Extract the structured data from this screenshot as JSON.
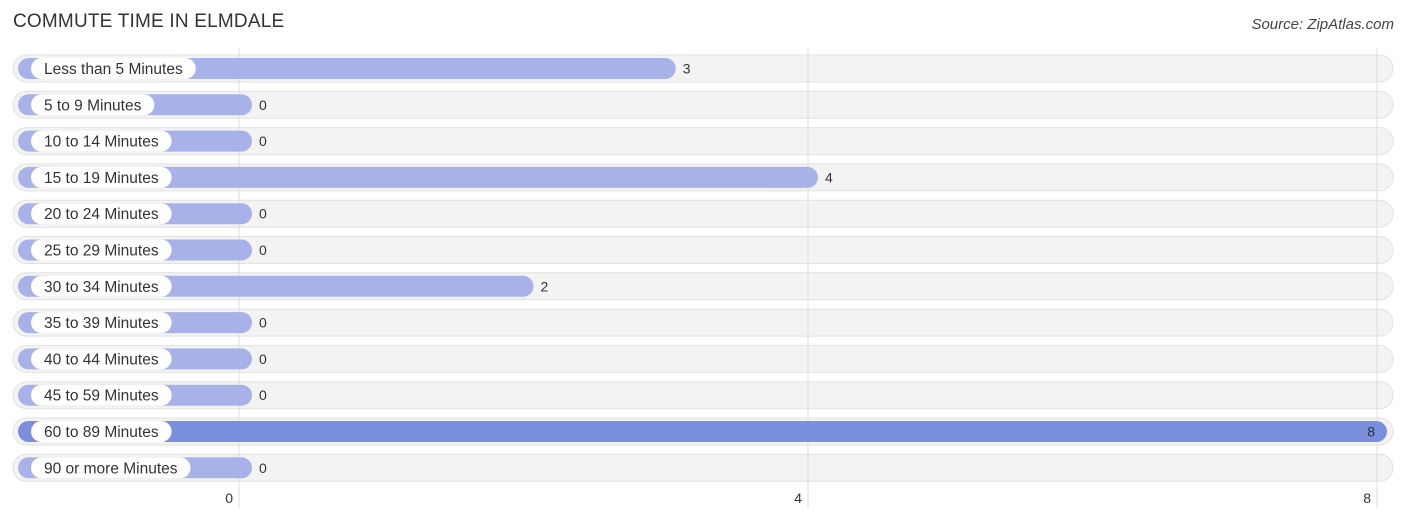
{
  "header": {
    "title": "COMMUTE TIME IN ELMDALE",
    "source": "Source: ZipAtlas.com"
  },
  "colors": {
    "bar": "#a7b3e8",
    "bar_highlight": "#7b8fdd",
    "track": "#f3f3f3",
    "grid": "#dddddd"
  },
  "chart_data": {
    "type": "bar",
    "orientation": "horizontal",
    "title": "COMMUTE TIME IN ELMDALE",
    "xlabel": "",
    "ylabel": "",
    "categories": [
      "Less than 5 Minutes",
      "5 to 9 Minutes",
      "10 to 14 Minutes",
      "15 to 19 Minutes",
      "20 to 24 Minutes",
      "25 to 29 Minutes",
      "30 to 34 Minutes",
      "35 to 39 Minutes",
      "40 to 44 Minutes",
      "45 to 59 Minutes",
      "60 to 89 Minutes",
      "90 or more Minutes"
    ],
    "values": [
      3,
      0,
      0,
      4,
      0,
      0,
      2,
      0,
      0,
      0,
      8,
      0
    ],
    "xlim": [
      0,
      8
    ],
    "xticks": [
      0,
      4,
      8
    ],
    "xtick_labels": [
      "0",
      "4",
      "8"
    ],
    "grid": true,
    "highlight_max": true
  }
}
